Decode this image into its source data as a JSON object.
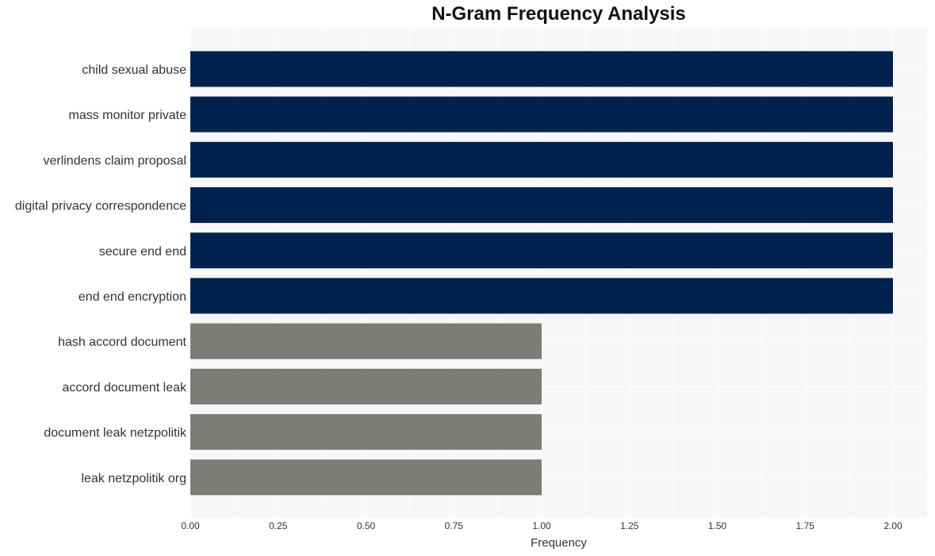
{
  "chart_data": {
    "type": "bar",
    "orientation": "horizontal",
    "title": "N-Gram Frequency Analysis",
    "xlabel": "Frequency",
    "ylabel": "",
    "xlim": [
      0,
      2.1
    ],
    "x_ticks": [
      "0.00",
      "0.25",
      "0.50",
      "0.75",
      "1.00",
      "1.25",
      "1.50",
      "1.75",
      "2.00"
    ],
    "x_tick_values": [
      0,
      0.25,
      0.5,
      0.75,
      1.0,
      1.25,
      1.5,
      1.75,
      2.0
    ],
    "grid": true,
    "categories": [
      "child sexual abuse",
      "mass monitor private",
      "verlindens claim proposal",
      "digital privacy correspondence",
      "secure end end",
      "end end encryption",
      "hash accord document",
      "accord document leak",
      "document leak netzpolitik",
      "leak netzpolitik org"
    ],
    "values": [
      2,
      2,
      2,
      2,
      2,
      2,
      1,
      1,
      1,
      1
    ],
    "colors": {
      "high": "#00224e",
      "low": "#7e7c77",
      "plot_background": "#f7f7f7",
      "grid": "#ffffff"
    }
  }
}
